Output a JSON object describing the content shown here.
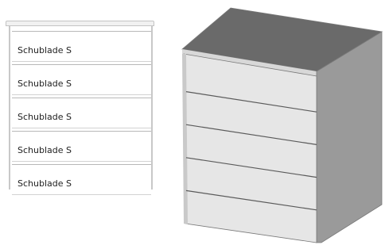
{
  "drawer_list": {
    "items": [
      {
        "label": "Schublade S"
      },
      {
        "label": "Schublade S"
      },
      {
        "label": "Schublade S"
      },
      {
        "label": "Schublade S"
      },
      {
        "label": "Schublade S"
      }
    ]
  },
  "illustration": {
    "drawer_count": 5,
    "colors": {
      "top": "#6a6a6a",
      "front": "#e6e6e6",
      "side": "#9a9a9a",
      "drawer_line": "#5a5a5a"
    }
  }
}
